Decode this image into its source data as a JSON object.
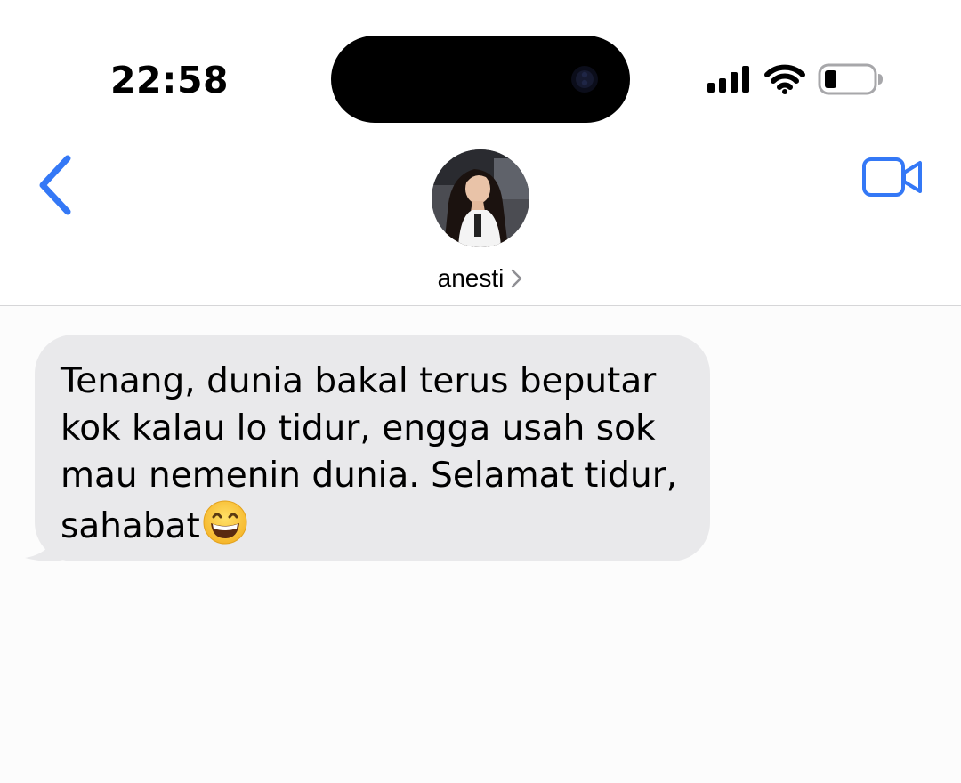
{
  "status_bar": {
    "time": "22:58",
    "icons": [
      "signal-bars-icon",
      "wifi-icon",
      "battery-low-icon"
    ]
  },
  "nav": {
    "back_icon": "chevron-left-icon",
    "video_icon": "facetime-video-icon",
    "contact_name": "anesti",
    "accent_color": "#3478f6"
  },
  "messages": [
    {
      "direction": "incoming",
      "text": "Tenang, dunia bakal terus beputar\nkok kalau lo tidur, engga usah sok\nmau nemenin dunia. Selamat tidur,\nsahabat",
      "trailing_emoji": "grinning-face-with-smiling-eyes-icon",
      "bubble_color": "#e9e9eb"
    }
  ]
}
